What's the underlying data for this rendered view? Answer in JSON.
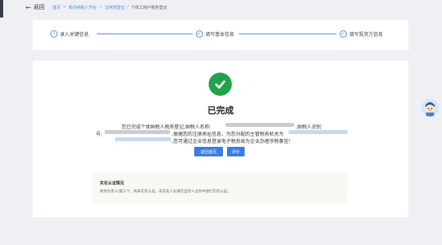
{
  "topbar": {
    "back_label": "返回",
    "breadcrumb": [
      "首页",
      "新办纳税人开业",
      "非常规登记"
    ],
    "current": "个体工商户税务登记"
  },
  "steps": [
    {
      "label": "录入关键信息"
    },
    {
      "label": "填写基本信息"
    },
    {
      "label": "填写投资方信息"
    }
  ],
  "result": {
    "title": "已完成",
    "line1_prefix": "您已完成个体纳税人税务登记,纳税人名称:",
    "line1_suffix": ",纳税人识别",
    "line2_prefix": "号:",
    "line2_mid": ",根据您的注册地址信息，为您分配的主管税务机关为",
    "line3_suffix": ",您可通过企业信息登录电子税务局为企业办理涉税事宜!"
  },
  "buttons": {
    "home_label": "返回首页",
    "rate_label": "评价"
  },
  "verify": {
    "title": "实名认证情况",
    "text": "财务负责人/第三个、尚未实名认证。未实名人员请在自然人业务中进行实名认证。"
  },
  "colors": {
    "accent": "#4a90e2",
    "success": "#20a34a",
    "button": "#3a7ee0"
  }
}
